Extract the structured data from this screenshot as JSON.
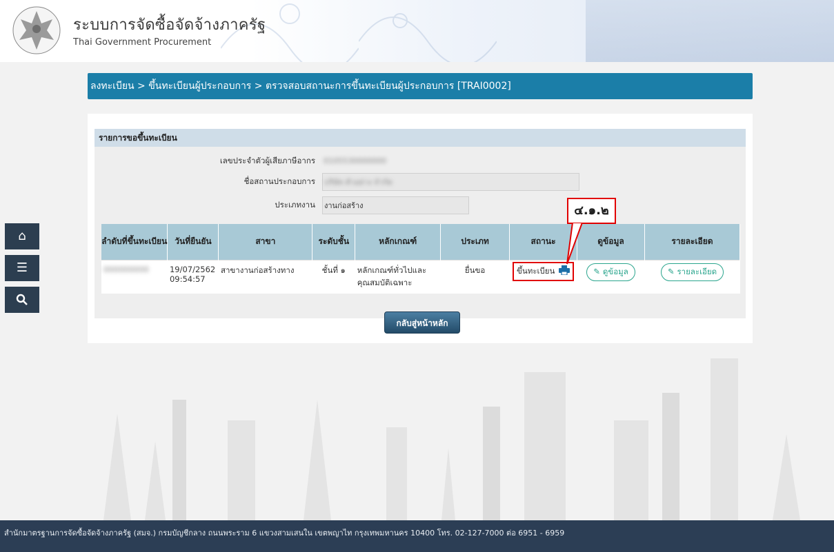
{
  "header": {
    "title_th": "ระบบการจัดซื้อจัดจ้างภาครัฐ",
    "title_en": "Thai Government Procurement"
  },
  "breadcrumb": "ลงทะเบียน > ขึ้นทะเบียนผู้ประกอบการ > ตรวจสอบสถานะการขึ้นทะเบียนผู้ประกอบการ [TRAI0002]",
  "section": {
    "title": "รายการขอขึ้นทะเบียน",
    "fields": {
      "tax_id_label": "เลขประจำตัวผู้เสียภาษีอากร",
      "tax_id_value": "0105530000000",
      "company_label": "ชื่อสถานประกอบการ",
      "company_value": "บริษัท ตัวอย่าง จำกัด",
      "work_type_label": "ประเภทงาน",
      "work_type_value": "งานก่อสร้าง"
    }
  },
  "table": {
    "headers": [
      "ลำดับที่ขึ้นทะเบียน",
      "วันที่ยืนยัน",
      "สาขา",
      "ระดับชั้น",
      "หลักเกณฑ์",
      "ประเภท",
      "สถานะ",
      "ดูข้อมูล",
      "รายละเอียด"
    ],
    "row": {
      "reg_no": "000000000",
      "date": "19/07/2562",
      "time": "09:54:57",
      "branch": "สาขางานก่อสร้างทาง",
      "level": "ชั้นที่ ๑",
      "criteria": "หลักเกณฑ์ทั่วไปและคุณสมบัติเฉพาะ",
      "type": "ยื่นขอ",
      "status": "ขึ้นทะเบียน",
      "view_label": "ดูข้อมูล",
      "detail_label": "รายละเอียด"
    }
  },
  "back_button": "กลับสู่หน้าหลัก",
  "callout": "๔.๑.๒",
  "sidebar": {
    "icons": [
      "home-icon",
      "menu-icon",
      "search-icon"
    ]
  },
  "footer": "สำนักมาตรฐานการจัดซื้อจัดจ้างภาครัฐ (สมจ.) กรมบัญชีกลาง ถนนพระราม 6 แขวงสามเสนใน เขตพญาไท กรุงเทพมหานคร 10400 โทร. 02-127-7000 ต่อ 6951 - 6959",
  "colors": {
    "breadcrumb_bg": "#1b7ea8",
    "table_header_bg": "#a8c9d6",
    "accent_green": "#2aa58d",
    "highlight_red": "#e10000",
    "footer_bg": "#2c3e55"
  }
}
